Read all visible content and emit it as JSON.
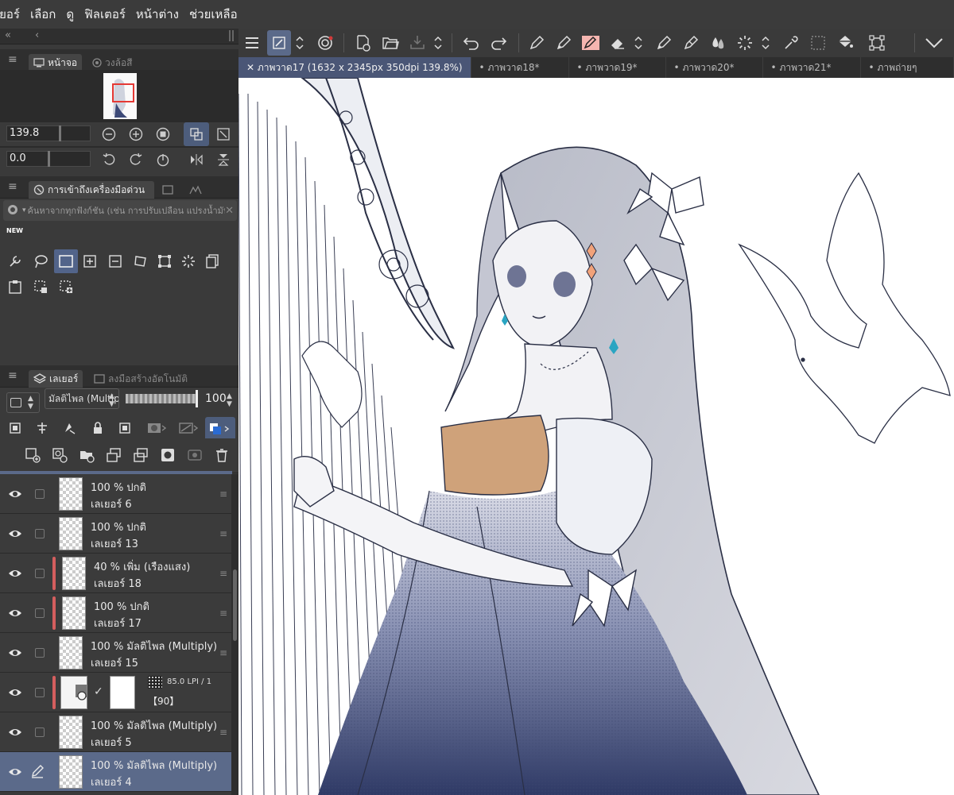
{
  "menu": [
    "เยอร์",
    "เลือก",
    "ดู",
    "ฟิลเตอร์",
    "หน้าต่าง",
    "ช่วยเหลือ"
  ],
  "navigator": {
    "tabs": [
      "หน้าจอ",
      "วงล้อสี"
    ],
    "zoom": "139.8",
    "rotation": "0.0"
  },
  "quick_access": {
    "tab_label": "การเข้าถึงเครื่องมือด่วน",
    "search_placeholder": "ค้นหาจากทุกฟังก์ชัน (เช่น การปรับเปลือน แปรงน้ำมัน)",
    "new_badge": "NEW"
  },
  "layer_panel": {
    "tabs": [
      "เลเยอร์",
      "ลงมือสร้างอัตโนมัติ"
    ],
    "blend_mode": "มัลติไพล (Multiply)",
    "opacity": "100",
    "layers": [
      {
        "opacity_mode": "100 % ปกติ",
        "name": "เลเยอร์ 6",
        "red": false,
        "selected": false
      },
      {
        "opacity_mode": "100 % ปกติ",
        "name": "เลเยอร์ 13",
        "red": false,
        "selected": false
      },
      {
        "opacity_mode": "40 % เพิ่ม (เรืองแสง)",
        "name": "เลเยอร์ 18",
        "red": true,
        "selected": false
      },
      {
        "opacity_mode": "100 % ปกติ",
        "name": "เลเยอร์ 17",
        "red": true,
        "selected": false
      },
      {
        "opacity_mode": "100 % มัลติไพล (Multiply)",
        "name": "เลเยอร์ 15",
        "red": false,
        "selected": false
      },
      {
        "opacity_mode": "85.0 LPI / 1",
        "name": "【90】",
        "red": true,
        "selected": false,
        "tone": true
      },
      {
        "opacity_mode": "100 % มัลติไพล (Multiply)",
        "name": "เลเยอร์ 5",
        "red": false,
        "selected": false
      },
      {
        "opacity_mode": "100 % มัลติไพล (Multiply)",
        "name": "เลเยอร์ 4",
        "red": false,
        "selected": true
      }
    ]
  },
  "documents": [
    {
      "label": "ภาพวาด17 (1632 x 2345px 350dpi 139.8%)",
      "active": true
    },
    {
      "label": "ภาพวาด18*",
      "active": false
    },
    {
      "label": "ภาพวาด19*",
      "active": false
    },
    {
      "label": "ภาพวาด20*",
      "active": false
    },
    {
      "label": "ภาพวาด21*",
      "active": false
    },
    {
      "label": "ภาพถ่ายๆ",
      "active": false
    }
  ],
  "colors": {
    "accent": "#5b6a8a",
    "layer_marker": "#d45e5e",
    "canvas": "#ffffff"
  }
}
